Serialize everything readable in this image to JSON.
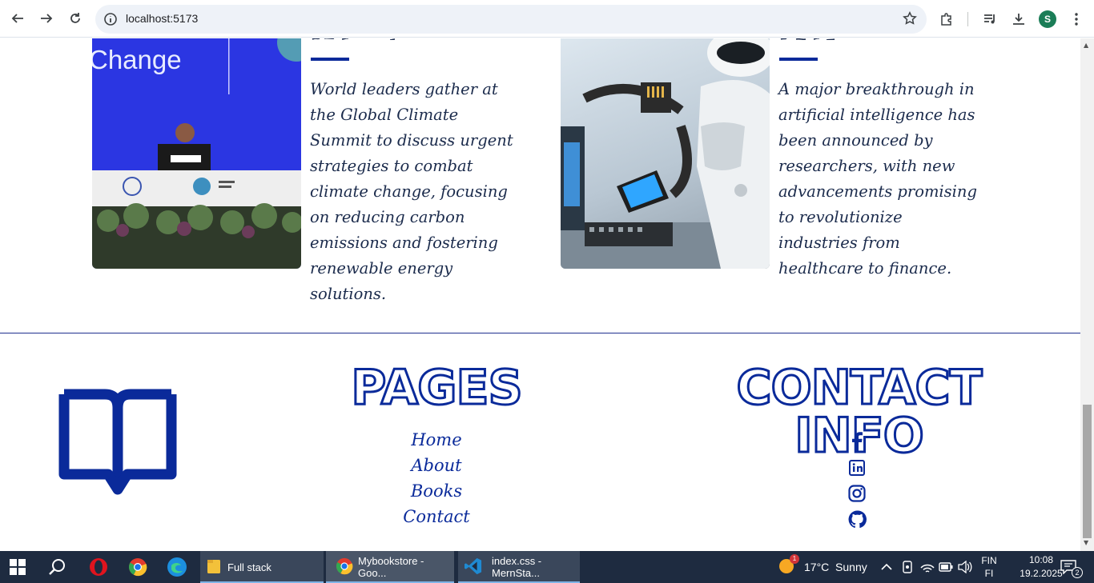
{
  "browser": {
    "url": "localhost:5173",
    "profile_initial": "S",
    "icons": [
      "back-icon",
      "forward-icon",
      "reload-icon",
      "info-icon",
      "bookmark-star-icon",
      "extensions-icon",
      "media-queue-icon",
      "download-icon",
      "menu-icon"
    ]
  },
  "articles": [
    {
      "image_label": "Change",
      "text": "World leaders gather at the Global Climate Summit to discuss urgent strategies to combat climate change, focusing on reducing carbon emissions and fostering renewable energy solutions."
    },
    {
      "text": "A major breakthrough in artificial intelligence has been announced by researchers, with new advancements promising to revolutionize industries from healthcare to finance."
    }
  ],
  "footer": {
    "logo_icon": "open-book-icon",
    "pages_heading": "PAGES",
    "links": [
      "Home",
      "About",
      "Books",
      "Contact"
    ],
    "contact_heading": "CONTACT INFO",
    "social_icons": [
      "facebook-icon",
      "linkedin-icon",
      "instagram-icon",
      "github-icon"
    ]
  },
  "taskbar": {
    "items": [
      {
        "label": "Full stack",
        "icon": "folder-icon"
      },
      {
        "label": "Mybookstore - Goo...",
        "icon": "chrome-icon"
      },
      {
        "label": "index.css - MernSta...",
        "icon": "vscode-icon"
      }
    ],
    "weather": "17°C  Sunny",
    "weather_badge": "1",
    "lang_top": "FIN",
    "lang_bottom": "FI",
    "time": "10:08",
    "date": "19.2.2025",
    "notification_count": "2"
  },
  "colors": {
    "accent": "#0a2a9a",
    "taskbar": "#1e2b40"
  }
}
